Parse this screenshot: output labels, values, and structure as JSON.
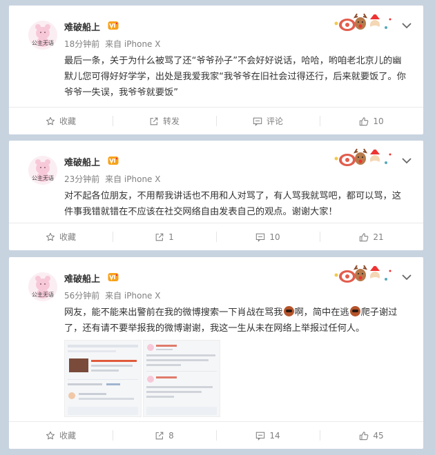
{
  "posts": [
    {
      "username": "难破船上",
      "avatar_caption": "公主无语",
      "time": "18分钟前",
      "source": "来自 iPhone X",
      "content": "最后一条，关于为什么被骂了还“爷爷孙子”不会好好说话，哈哈，哟咱老北京儿的幽默儿您可得好好学学，出处是我爱我家“我爷爷在旧社会过得还行，后来就要饭了。你爷爷一失误，我爷爷就要饭”",
      "actions": {
        "favorite": "收藏",
        "repost": "转发",
        "comment": "评论",
        "like": "10"
      }
    },
    {
      "username": "难破船上",
      "avatar_caption": "公主无语",
      "time": "23分钟前",
      "source": "来自 iPhone X",
      "content": "对不起各位朋友，不用帮我讲话也不用和人对骂了，有人骂我就骂吧，都可以骂，这件事我错就错在不应该在社交网络自由发表自己的观点。谢谢大家！",
      "actions": {
        "favorite": "收藏",
        "repost": "1",
        "comment": "10",
        "like": "21"
      }
    },
    {
      "username": "难破船上",
      "avatar_caption": "公主无语",
      "time": "56分钟前",
      "source": "来自 iPhone X",
      "content_a": "网友，能不能来出警前在我的微博搜索一下肖战在骂我",
      "content_b": "啊，简中在逃",
      "content_c": "爬子谢过了，还有请不要举报我的微博谢谢，我这一生从未在网络上举报过任何人。",
      "actions": {
        "favorite": "收藏",
        "repost": "8",
        "comment": "14",
        "like": "45"
      }
    }
  ],
  "icons": [
    "star-icon",
    "repost-icon",
    "comment-icon",
    "like-icon",
    "chevron-down-icon",
    "vip-badge-icon"
  ],
  "colors": {
    "background": "#c8d3e0",
    "card": "#ffffff",
    "meta_text": "#808080",
    "badge": "#f7a21a"
  }
}
